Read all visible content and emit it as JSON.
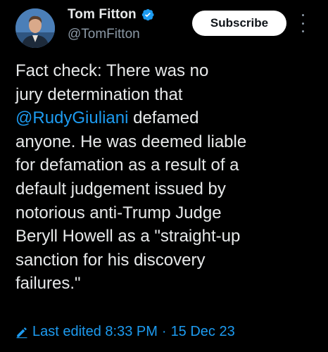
{
  "author": {
    "display_name": "Tom Fitton",
    "handle": "@TomFitton",
    "avatar_icon": "user-avatar",
    "verified_icon": "verified-badge-icon",
    "verified_color": "#1d9bf0"
  },
  "actions": {
    "subscribe_label": "Subscribe",
    "more_icon": "more-options-icon"
  },
  "tweet": {
    "line1": "Fact check: There was no",
    "line2": "jury determination that",
    "line3_mention": "@RudyGiuliani",
    "line3_rest": " defamed",
    "line4": "anyone. He was deemed liable",
    "line5": "for defamation as a result of a",
    "line6": "default judgement issued by",
    "line7": "notorious anti-Trump Judge",
    "line8": "Beryll Howell as a \"straight-up",
    "line9": "sanction for his discovery",
    "line10": "failures.\""
  },
  "edit_info": {
    "icon": "pencil-icon",
    "label": "Last edited 8:33 PM",
    "separator": "·",
    "date": "15 Dec 23"
  },
  "colors": {
    "background": "#000000",
    "text": "#e7e9ea",
    "secondary": "#8b98a5",
    "link": "#1d9bf0"
  }
}
